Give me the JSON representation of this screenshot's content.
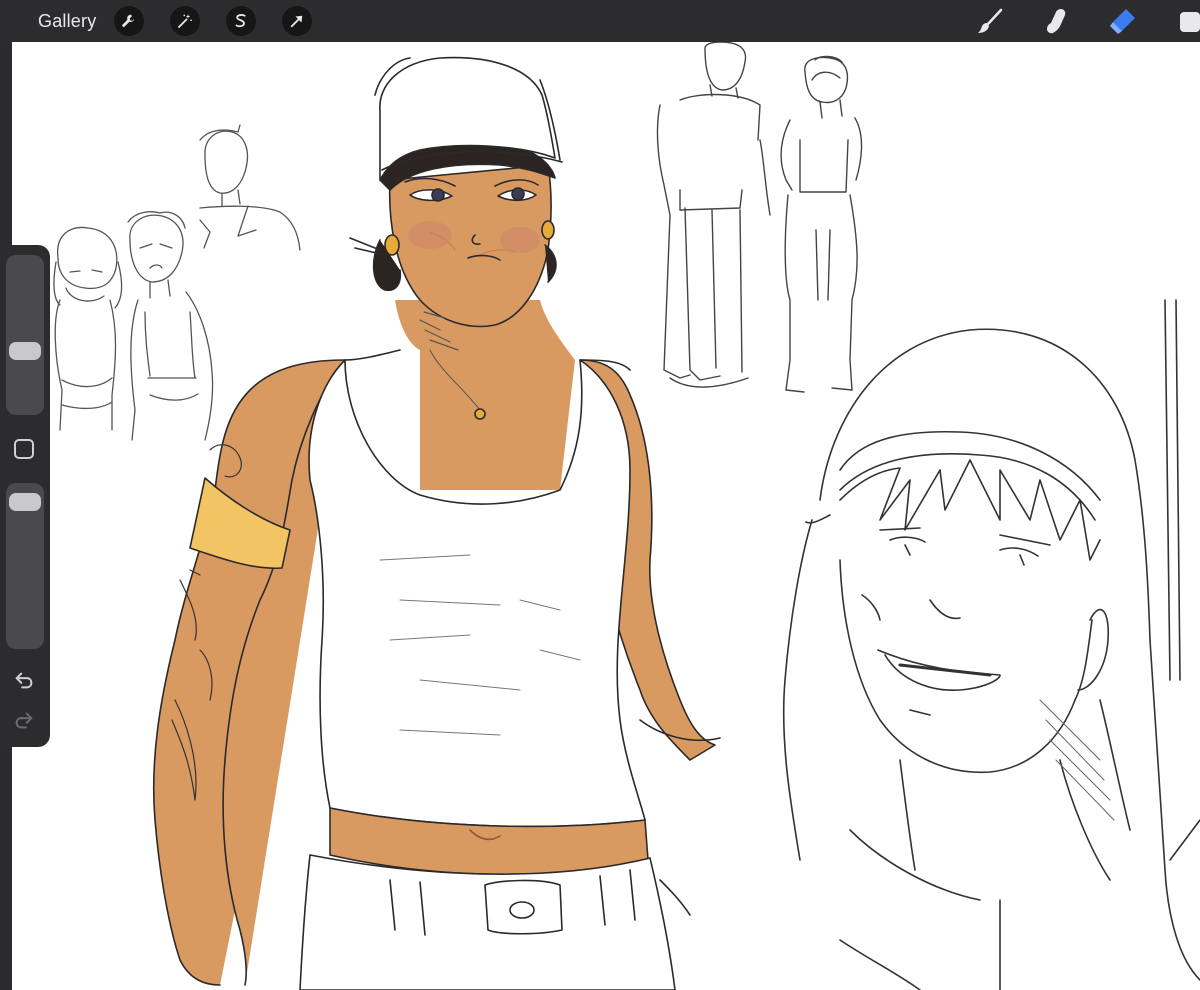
{
  "topbar": {
    "gallery_label": "Gallery",
    "left_tools": [
      {
        "name": "actions",
        "icon": "wrench-icon"
      },
      {
        "name": "adjustments",
        "icon": "magic-wand-icon"
      },
      {
        "name": "selection",
        "icon": "selection-s-icon"
      },
      {
        "name": "transform",
        "icon": "arrow-cursor-icon"
      }
    ],
    "right_tools": [
      {
        "name": "brush",
        "icon": "brush-icon",
        "active": false
      },
      {
        "name": "smudge",
        "icon": "smudge-finger-icon",
        "active": false
      },
      {
        "name": "eraser",
        "icon": "eraser-icon",
        "active": true
      },
      {
        "name": "layers",
        "icon": "layers-icon",
        "active": false
      }
    ]
  },
  "sidebar": {
    "brush_size": 0.38,
    "opacity": 0.95,
    "undo_icon": "undo-arrow-icon",
    "redo_icon": "redo-arrow-icon",
    "modify_icon": "square-modify-icon"
  },
  "colors": {
    "chrome": "#2c2c2e",
    "button_bg": "#161617",
    "icon": "#e9e9ec",
    "eraser_active": "#3a7bf0",
    "skin": "#d99a62",
    "armband": "#f3c463",
    "canvas": "#ffffff"
  }
}
